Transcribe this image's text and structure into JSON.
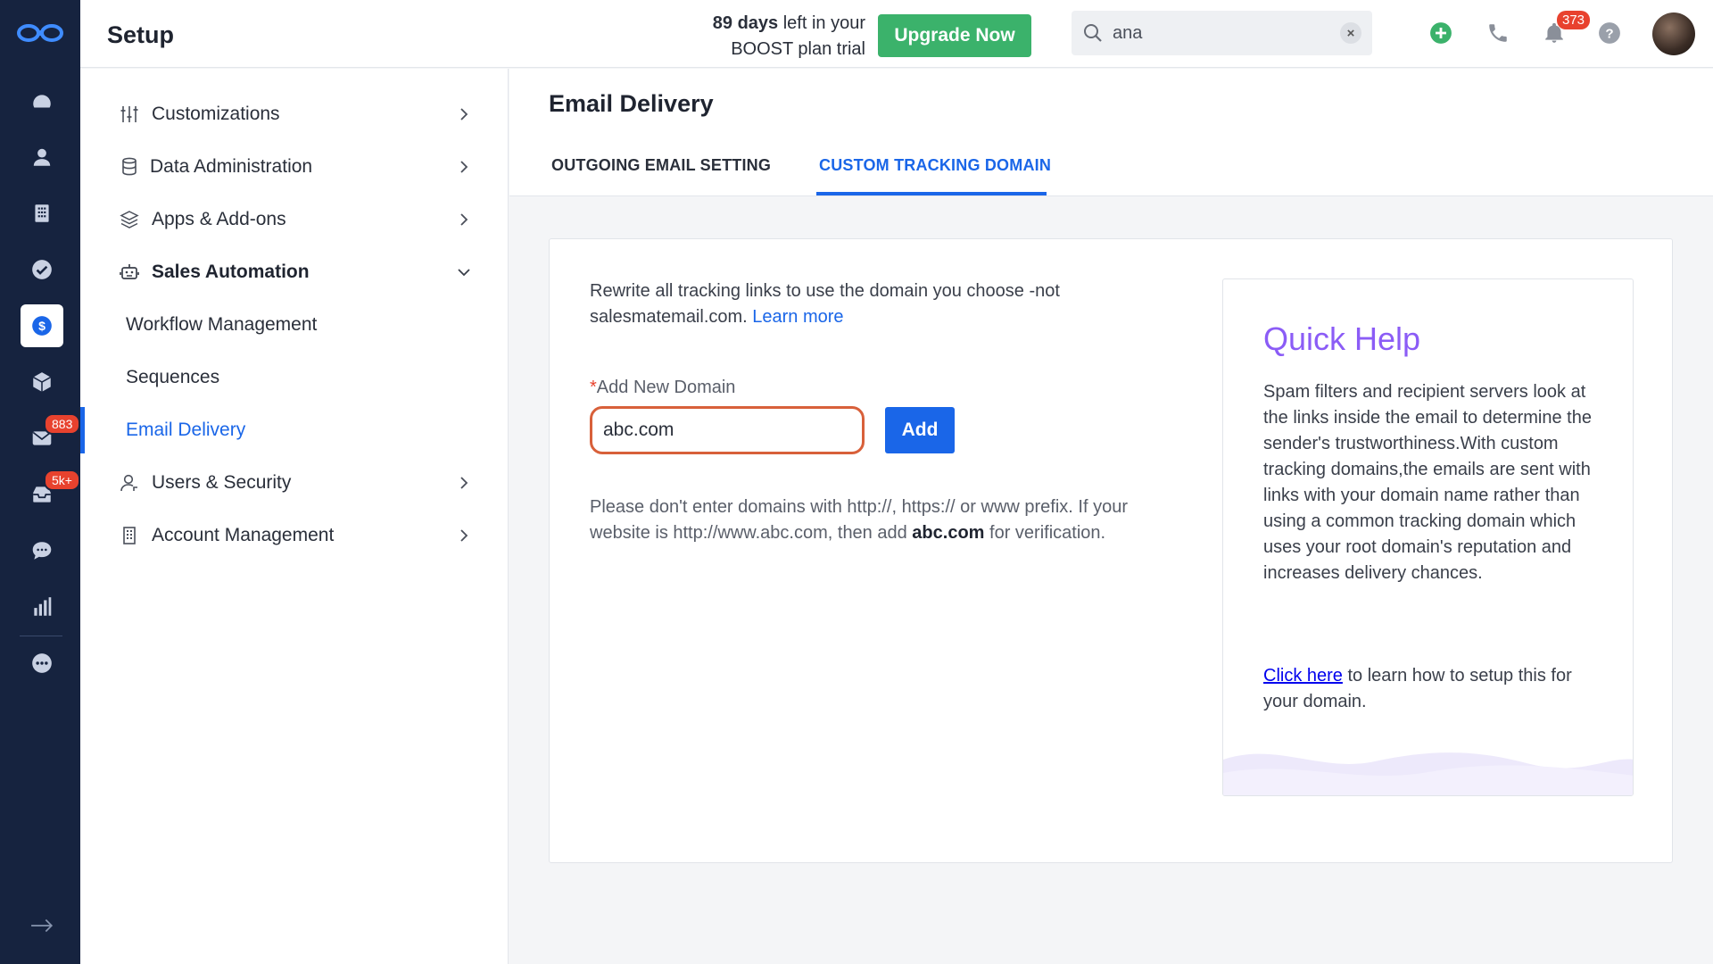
{
  "header": {
    "title": "Setup",
    "trial_days": "89 days",
    "trial_rest_line1": " left in your",
    "trial_line2": "BOOST plan trial",
    "upgrade_label": "Upgrade Now",
    "search_value": "ana",
    "notifications_count": "373"
  },
  "rail": {
    "mail_badge": "883",
    "inbox_badge": "5k+"
  },
  "sidebar": {
    "items": [
      {
        "label": "Customizations"
      },
      {
        "label": "Data Administration"
      },
      {
        "label": "Apps & Add-ons"
      },
      {
        "label": "Sales Automation"
      },
      {
        "label": "Workflow Management"
      },
      {
        "label": "Sequences"
      },
      {
        "label": "Email Delivery"
      },
      {
        "label": "Users & Security"
      },
      {
        "label": "Account Management"
      }
    ]
  },
  "main": {
    "title": "Email Delivery",
    "tabs": [
      {
        "label": "OUTGOING EMAIL SETTING"
      },
      {
        "label": "CUSTOM TRACKING DOMAIN"
      }
    ],
    "description": "Rewrite all tracking links to use the domain you choose -not salesmatemail.com.",
    "learn_more": "Learn more",
    "field_required_mark": "*",
    "field_label": "Add New Domain",
    "domain_value": "abc.com",
    "add_label": "Add",
    "hint_prefix": "Please don't enter domains with http://, https:// or www prefix. If your website is http://www.abc.com, then add ",
    "hint_bold": "abc.com",
    "hint_suffix": " for verification."
  },
  "quick_help": {
    "title": "Quick Help",
    "body": "Spam filters and recipient servers look at the links inside the email to determine the sender's trustworthiness.With custom tracking domains,the emails are sent with links with your domain name rather than using a common tracking domain which uses your root domain's reputation and increases delivery chances.",
    "link_label": "Click here",
    "link_suffix": " to learn how to setup this for your domain."
  },
  "colors": {
    "rail_bg": "#16233f",
    "accent": "#1a66e8",
    "upgrade_green": "#3bb26b",
    "badge_red": "#e8422e",
    "input_highlight": "#d8603a",
    "quick_help_purple": "#8b5cf6"
  }
}
